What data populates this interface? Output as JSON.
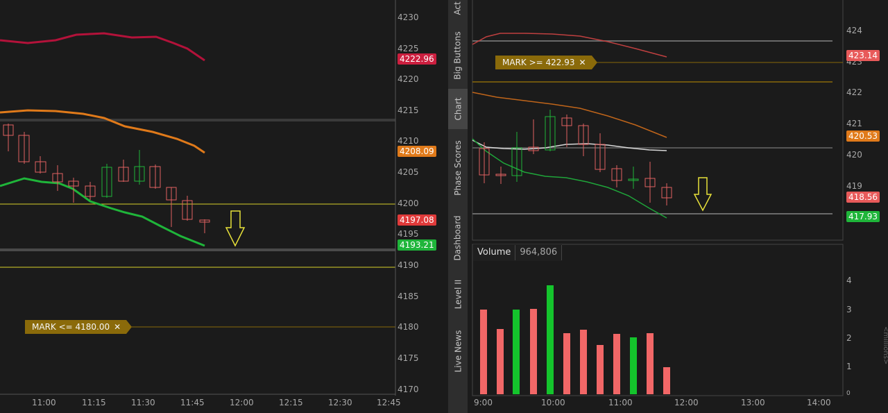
{
  "left_chart": {
    "price_axis": [
      "4230",
      "4225",
      "4220",
      "4215",
      "4210",
      "4205",
      "4200",
      "4195",
      "4190",
      "4185",
      "4180",
      "4175",
      "4170"
    ],
    "time_axis": [
      "11:00",
      "11:15",
      "11:30",
      "11:45",
      "12:00",
      "12:15",
      "12:30",
      "12:45"
    ],
    "badges": {
      "upper_band": {
        "text": "4222.96",
        "color": "#cc1f3f"
      },
      "mid_band": {
        "text": "4208.09",
        "color": "#e07a1a"
      },
      "last_price": {
        "text": "4197.08",
        "color": "#e03a3a"
      },
      "lower_band": {
        "text": "4193.21",
        "color": "#1fb53a"
      }
    },
    "alert": {
      "label": "MARK <= 4180.00",
      "close": "✕"
    }
  },
  "side_tabs": [
    "Active Trader",
    "Big Buttons",
    "Chart",
    "Phase Scores",
    "Dashboard",
    "Level II",
    "Live News"
  ],
  "side_tabs_visible": [
    "Act",
    "Big Buttons",
    "Chart",
    "Phase Scores",
    "Dashboard",
    "Level II",
    "Live News"
  ],
  "active_tab": "Chart",
  "right_chart": {
    "price_axis": [
      "424",
      "423",
      "422",
      "421",
      "420",
      "419"
    ],
    "time_axis": [
      "9:00",
      "10:00",
      "11:00",
      "12:00",
      "13:00",
      "14:00"
    ],
    "badges": {
      "upper_band": {
        "text": "423.14",
        "color": "#e85a5a"
      },
      "mid_band": {
        "text": "420.53",
        "color": "#e07a1a"
      },
      "last_price": {
        "text": "418.56",
        "color": "#e85a5a"
      },
      "lower_band": {
        "text": "417.93",
        "color": "#1fb53a"
      }
    },
    "alert": {
      "label": "MARK >= 422.93",
      "close": "✕"
    }
  },
  "volume_panel": {
    "title": "Volume",
    "value": "964,806",
    "axis": [
      "4",
      "3",
      "2",
      "1",
      "0"
    ]
  }
}
